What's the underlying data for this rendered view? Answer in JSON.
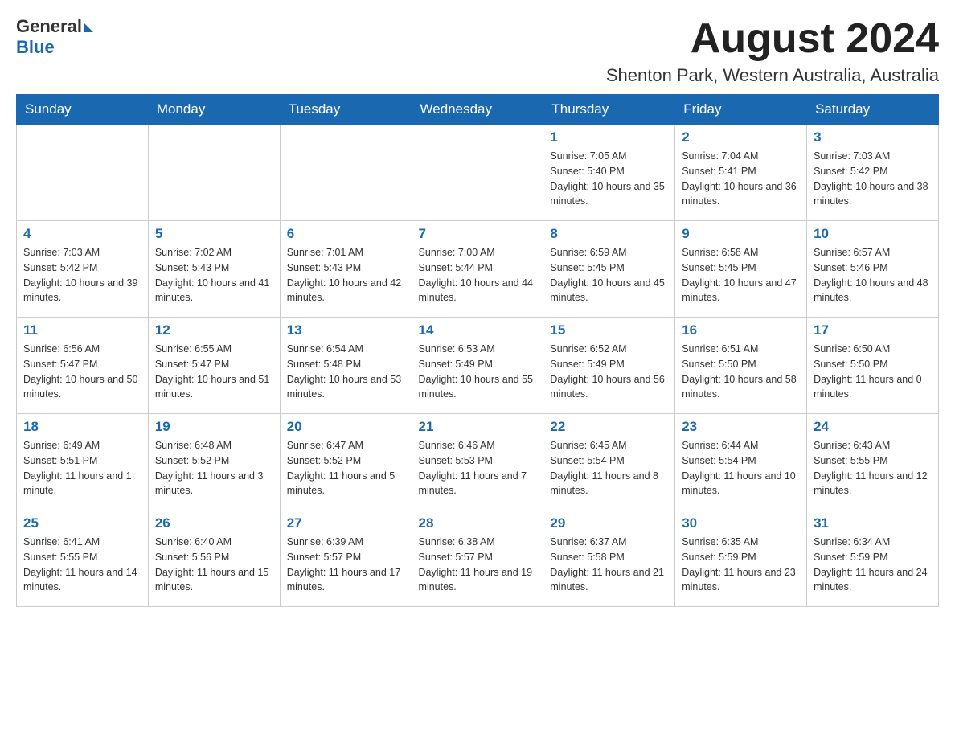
{
  "logo": {
    "text_general": "General",
    "text_blue": "Blue"
  },
  "title": "August 2024",
  "location": "Shenton Park, Western Australia, Australia",
  "days_of_week": [
    "Sunday",
    "Monday",
    "Tuesday",
    "Wednesday",
    "Thursday",
    "Friday",
    "Saturday"
  ],
  "weeks": [
    [
      {
        "day": "",
        "info": ""
      },
      {
        "day": "",
        "info": ""
      },
      {
        "day": "",
        "info": ""
      },
      {
        "day": "",
        "info": ""
      },
      {
        "day": "1",
        "info": "Sunrise: 7:05 AM\nSunset: 5:40 PM\nDaylight: 10 hours and 35 minutes."
      },
      {
        "day": "2",
        "info": "Sunrise: 7:04 AM\nSunset: 5:41 PM\nDaylight: 10 hours and 36 minutes."
      },
      {
        "day": "3",
        "info": "Sunrise: 7:03 AM\nSunset: 5:42 PM\nDaylight: 10 hours and 38 minutes."
      }
    ],
    [
      {
        "day": "4",
        "info": "Sunrise: 7:03 AM\nSunset: 5:42 PM\nDaylight: 10 hours and 39 minutes."
      },
      {
        "day": "5",
        "info": "Sunrise: 7:02 AM\nSunset: 5:43 PM\nDaylight: 10 hours and 41 minutes."
      },
      {
        "day": "6",
        "info": "Sunrise: 7:01 AM\nSunset: 5:43 PM\nDaylight: 10 hours and 42 minutes."
      },
      {
        "day": "7",
        "info": "Sunrise: 7:00 AM\nSunset: 5:44 PM\nDaylight: 10 hours and 44 minutes."
      },
      {
        "day": "8",
        "info": "Sunrise: 6:59 AM\nSunset: 5:45 PM\nDaylight: 10 hours and 45 minutes."
      },
      {
        "day": "9",
        "info": "Sunrise: 6:58 AM\nSunset: 5:45 PM\nDaylight: 10 hours and 47 minutes."
      },
      {
        "day": "10",
        "info": "Sunrise: 6:57 AM\nSunset: 5:46 PM\nDaylight: 10 hours and 48 minutes."
      }
    ],
    [
      {
        "day": "11",
        "info": "Sunrise: 6:56 AM\nSunset: 5:47 PM\nDaylight: 10 hours and 50 minutes."
      },
      {
        "day": "12",
        "info": "Sunrise: 6:55 AM\nSunset: 5:47 PM\nDaylight: 10 hours and 51 minutes."
      },
      {
        "day": "13",
        "info": "Sunrise: 6:54 AM\nSunset: 5:48 PM\nDaylight: 10 hours and 53 minutes."
      },
      {
        "day": "14",
        "info": "Sunrise: 6:53 AM\nSunset: 5:49 PM\nDaylight: 10 hours and 55 minutes."
      },
      {
        "day": "15",
        "info": "Sunrise: 6:52 AM\nSunset: 5:49 PM\nDaylight: 10 hours and 56 minutes."
      },
      {
        "day": "16",
        "info": "Sunrise: 6:51 AM\nSunset: 5:50 PM\nDaylight: 10 hours and 58 minutes."
      },
      {
        "day": "17",
        "info": "Sunrise: 6:50 AM\nSunset: 5:50 PM\nDaylight: 11 hours and 0 minutes."
      }
    ],
    [
      {
        "day": "18",
        "info": "Sunrise: 6:49 AM\nSunset: 5:51 PM\nDaylight: 11 hours and 1 minute."
      },
      {
        "day": "19",
        "info": "Sunrise: 6:48 AM\nSunset: 5:52 PM\nDaylight: 11 hours and 3 minutes."
      },
      {
        "day": "20",
        "info": "Sunrise: 6:47 AM\nSunset: 5:52 PM\nDaylight: 11 hours and 5 minutes."
      },
      {
        "day": "21",
        "info": "Sunrise: 6:46 AM\nSunset: 5:53 PM\nDaylight: 11 hours and 7 minutes."
      },
      {
        "day": "22",
        "info": "Sunrise: 6:45 AM\nSunset: 5:54 PM\nDaylight: 11 hours and 8 minutes."
      },
      {
        "day": "23",
        "info": "Sunrise: 6:44 AM\nSunset: 5:54 PM\nDaylight: 11 hours and 10 minutes."
      },
      {
        "day": "24",
        "info": "Sunrise: 6:43 AM\nSunset: 5:55 PM\nDaylight: 11 hours and 12 minutes."
      }
    ],
    [
      {
        "day": "25",
        "info": "Sunrise: 6:41 AM\nSunset: 5:55 PM\nDaylight: 11 hours and 14 minutes."
      },
      {
        "day": "26",
        "info": "Sunrise: 6:40 AM\nSunset: 5:56 PM\nDaylight: 11 hours and 15 minutes."
      },
      {
        "day": "27",
        "info": "Sunrise: 6:39 AM\nSunset: 5:57 PM\nDaylight: 11 hours and 17 minutes."
      },
      {
        "day": "28",
        "info": "Sunrise: 6:38 AM\nSunset: 5:57 PM\nDaylight: 11 hours and 19 minutes."
      },
      {
        "day": "29",
        "info": "Sunrise: 6:37 AM\nSunset: 5:58 PM\nDaylight: 11 hours and 21 minutes."
      },
      {
        "day": "30",
        "info": "Sunrise: 6:35 AM\nSunset: 5:59 PM\nDaylight: 11 hours and 23 minutes."
      },
      {
        "day": "31",
        "info": "Sunrise: 6:34 AM\nSunset: 5:59 PM\nDaylight: 11 hours and 24 minutes."
      }
    ]
  ]
}
